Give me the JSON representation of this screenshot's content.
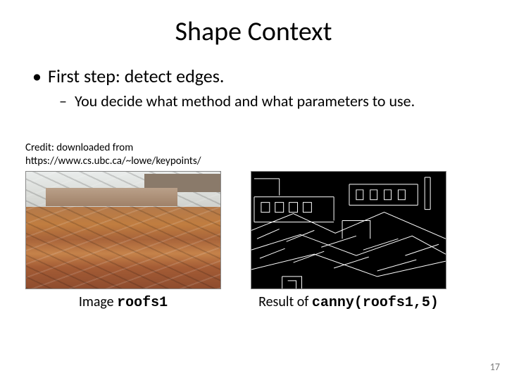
{
  "title": "Shape Context",
  "bullets": {
    "level1": "First step: detect edges.",
    "level2": "You decide what method and what parameters to use."
  },
  "credit": {
    "line1": "Credit: downloaded from",
    "line2": "https://www.cs.ubc.ca/~lowe/keypoints/"
  },
  "figures": {
    "left": {
      "caption_prefix": "Image ",
      "caption_code": "roofs1"
    },
    "right": {
      "caption_prefix": "Result of ",
      "caption_code": "canny(roofs1,5)"
    }
  },
  "page_number": "17"
}
